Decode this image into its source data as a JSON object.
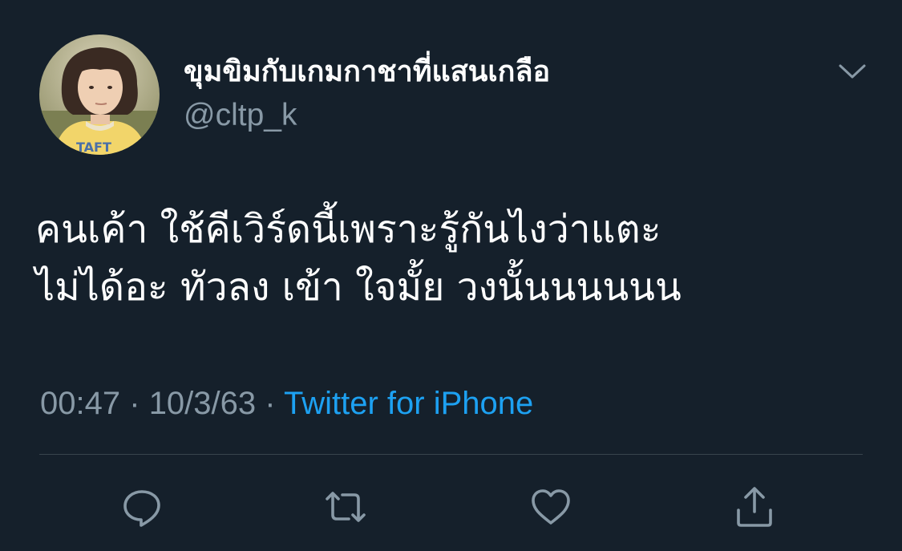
{
  "user": {
    "display_name": "ขุมขิมกับเกมกาชาที่แสนเกลือ",
    "handle": "@cltp_k"
  },
  "tweet": {
    "text_lines": [
      "คนเค้า ใช้คีเวิร์ดนี้เพราะรู้กันไงว่าแตะ",
      "ไม่ได้อะ ทัวลง เข้า ใจมั้ย วงนั้นนนนนน"
    ],
    "time": "00:47",
    "date": "10/3/63",
    "separator": "·",
    "source": "Twitter for iPhone"
  },
  "actions": {
    "reply_icon": "reply-icon",
    "retweet_icon": "retweet-icon",
    "like_icon": "heart-icon",
    "share_icon": "share-icon"
  },
  "colors": {
    "background": "#15202b",
    "text": "#ffffff",
    "secondary_text": "#8899a6",
    "link": "#1da1f2",
    "divider": "#38444d"
  }
}
